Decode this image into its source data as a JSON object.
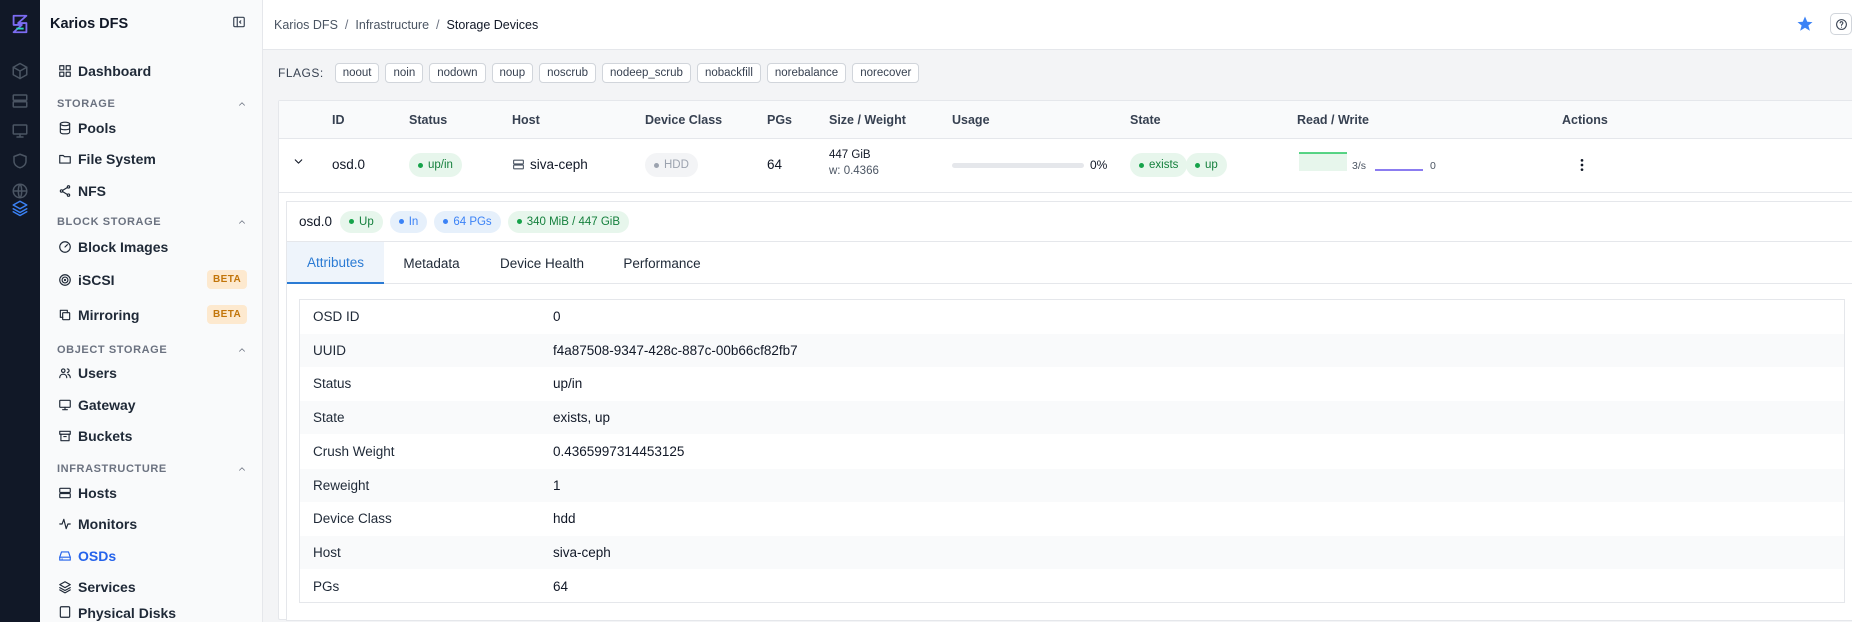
{
  "app": {
    "name": "Karios DFS"
  },
  "breadcrumbs": [
    "Karios DFS",
    "Infrastructure",
    "Storage Devices"
  ],
  "sidebar": {
    "dashboard": "Dashboard",
    "sections": {
      "storage": "STORAGE",
      "block": "BLOCK STORAGE",
      "object": "OBJECT STORAGE",
      "infra": "INFRASTRUCTURE"
    },
    "items": {
      "pools": "Pools",
      "filesystem": "File System",
      "nfs": "NFS",
      "block_images": "Block Images",
      "iscsi": "iSCSI",
      "mirroring": "Mirroring",
      "users": "Users",
      "gateway": "Gateway",
      "buckets": "Buckets",
      "hosts": "Hosts",
      "monitors": "Monitors",
      "osds": "OSDs",
      "services": "Services",
      "physical_disks": "Physical Disks"
    },
    "beta_label": "BETA"
  },
  "flags": {
    "label": "FLAGS:",
    "items": [
      "noout",
      "noin",
      "nodown",
      "noup",
      "noscrub",
      "nodeep_scrub",
      "nobackfill",
      "norebalance",
      "norecover"
    ]
  },
  "table": {
    "headers": {
      "id": "ID",
      "status": "Status",
      "host": "Host",
      "device_class": "Device Class",
      "pgs": "PGs",
      "size_weight": "Size / Weight",
      "usage": "Usage",
      "state": "State",
      "read_write": "Read / Write",
      "actions": "Actions"
    },
    "row": {
      "id": "osd.0",
      "status": "up/in",
      "host": "siva-ceph",
      "device_class": "HDD",
      "pgs": "64",
      "size": "447 GiB",
      "weight": "w: 0.4366",
      "usage_pct": "0%",
      "usage_fraction": 0.0,
      "state_1": "exists",
      "state_2": "up",
      "read_rate": "3/s",
      "write_rate": "0"
    }
  },
  "detail": {
    "osd": "osd.0",
    "badges": [
      "Up",
      "In",
      "64 PGs",
      "340 MiB / 447 GiB"
    ],
    "tabs": [
      "Attributes",
      "Metadata",
      "Device Health",
      "Performance"
    ],
    "attributes": [
      {
        "key": "OSD ID",
        "value": "0"
      },
      {
        "key": "UUID",
        "value": "f4a87508-9347-428c-887c-00b66cf82fb7"
      },
      {
        "key": "Status",
        "value": "up/in"
      },
      {
        "key": "State",
        "value": "exists, up"
      },
      {
        "key": "Crush Weight",
        "value": "0.4365997314453125"
      },
      {
        "key": "Reweight",
        "value": "1"
      },
      {
        "key": "Device Class",
        "value": "hdd"
      },
      {
        "key": "Host",
        "value": "siva-ceph"
      },
      {
        "key": "PGs",
        "value": "64"
      }
    ]
  },
  "colors": {
    "accent": "#2b7bd4",
    "green": "#16a34a",
    "rail": "#111827",
    "star": "#3b82f6"
  }
}
